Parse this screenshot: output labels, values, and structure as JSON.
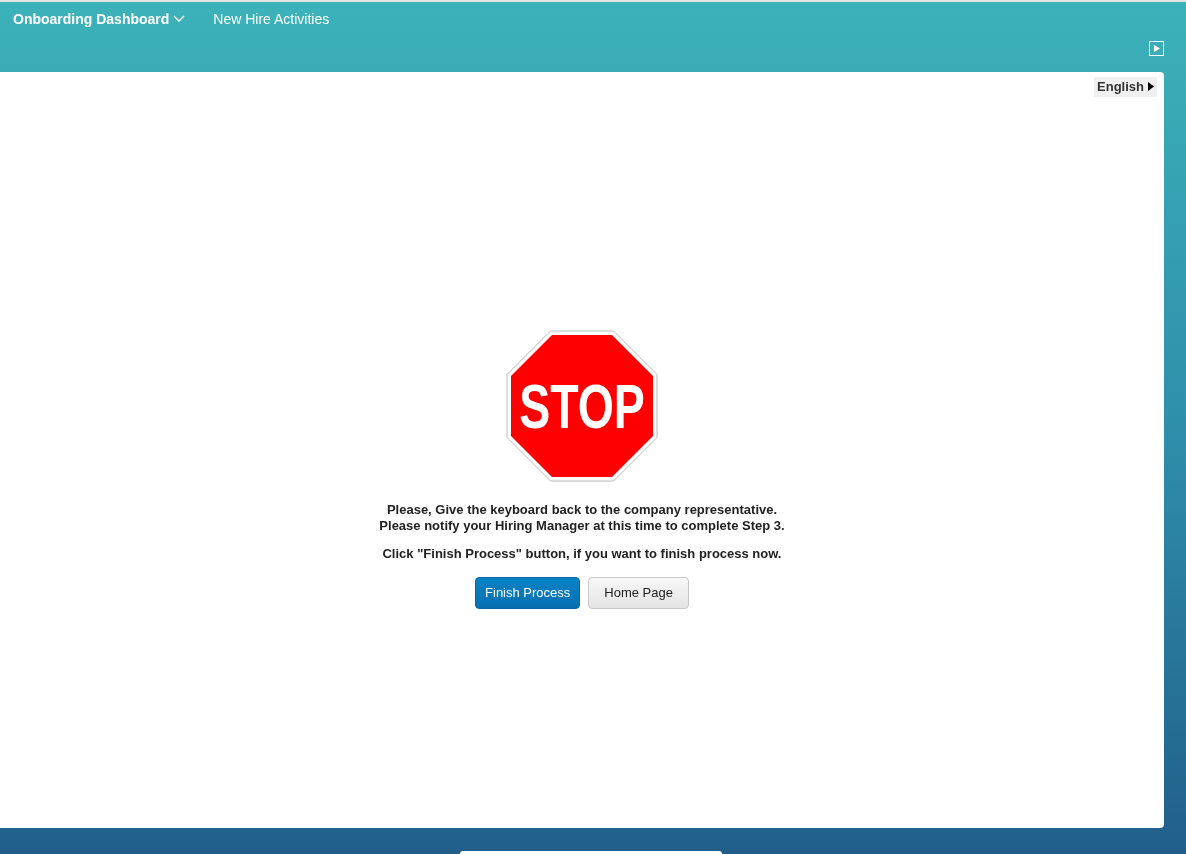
{
  "nav": {
    "items": [
      {
        "label": "Onboarding Dashboard",
        "kind": "dropdown"
      },
      {
        "label": "New Hire Activities",
        "kind": "link"
      }
    ]
  },
  "language": {
    "label": "English"
  },
  "stop_sign": {
    "text": "STOP"
  },
  "messages": [
    "Please, Give the keyboard back to the company representative.",
    "Please notify your Hiring Manager at this time to complete Step 3."
  ],
  "instruction": "Click \"Finish Process\" button, if you want to finish process now.",
  "buttons": [
    {
      "label": "Finish Process",
      "kind": "primary"
    },
    {
      "label": "Home Page",
      "kind": "secondary"
    }
  ]
}
